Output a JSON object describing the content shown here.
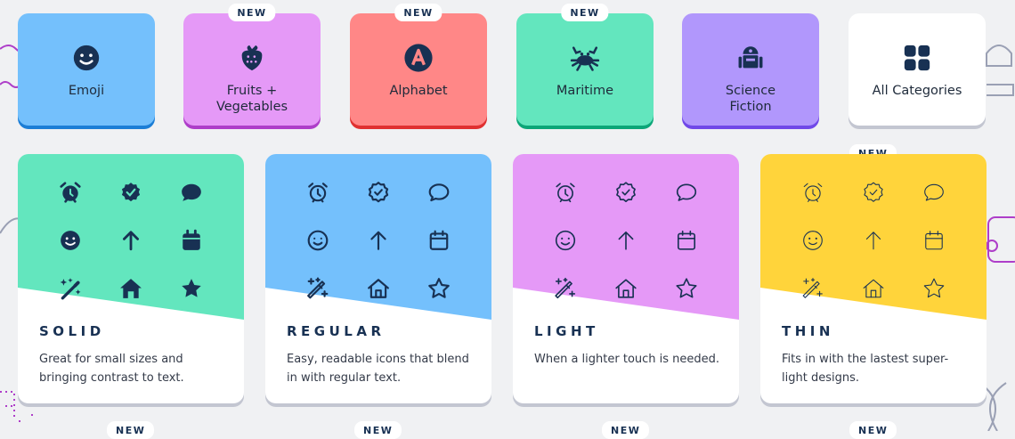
{
  "categories": [
    {
      "label": "Emoji",
      "icon": "face-smile-icon",
      "color": "#74c0fc",
      "shade": "#1c7ed6",
      "badge": ""
    },
    {
      "label": "Fruits +\nVegetables",
      "icon": "strawberry-icon",
      "color": "#e599f7",
      "shade": "#ae3ec9",
      "badge": "NEW"
    },
    {
      "label": "Alphabet",
      "icon": "circle-a-icon",
      "color": "#ff8787",
      "shade": "#e03131",
      "badge": "NEW"
    },
    {
      "label": "Maritime",
      "icon": "crab-icon",
      "color": "#63e6be",
      "shade": "#0ca678",
      "badge": "NEW"
    },
    {
      "label": "Science\nFiction",
      "icon": "robot-icon",
      "color": "#b197fc",
      "shade": "#7048e8",
      "badge": ""
    },
    {
      "label": "All Categories",
      "icon": "grid-icon",
      "color": "#ffffff",
      "shade": "#c3c6d1",
      "badge": ""
    }
  ],
  "styles": [
    {
      "title": "SOLID",
      "desc": "Great for small sizes and bringing contrast to text.",
      "color": "#63e6be",
      "weight": "solid",
      "badge": ""
    },
    {
      "title": "REGULAR",
      "desc": "Easy, readable icons that blend in with regular text.",
      "color": "#74c0fc",
      "weight": "regular",
      "badge": ""
    },
    {
      "title": "LIGHT",
      "desc": "When a lighter touch is needed.",
      "color": "#e599f7",
      "weight": "light",
      "badge": ""
    },
    {
      "title": "THIN",
      "desc": "Fits in with the lastest super-light designs.",
      "color": "#ffd43b",
      "weight": "thin",
      "badge": "NEW"
    }
  ],
  "card_icons": [
    "alarm-clock-icon",
    "badge-check-icon",
    "comment-icon",
    "face-smile-icon",
    "arrow-up-icon",
    "calendar-icon",
    "wand-sparkles-icon",
    "house-icon",
    "star-icon"
  ],
  "bottom_badges": [
    "NEW",
    "NEW",
    "NEW",
    "NEW"
  ],
  "ink": "#183153"
}
